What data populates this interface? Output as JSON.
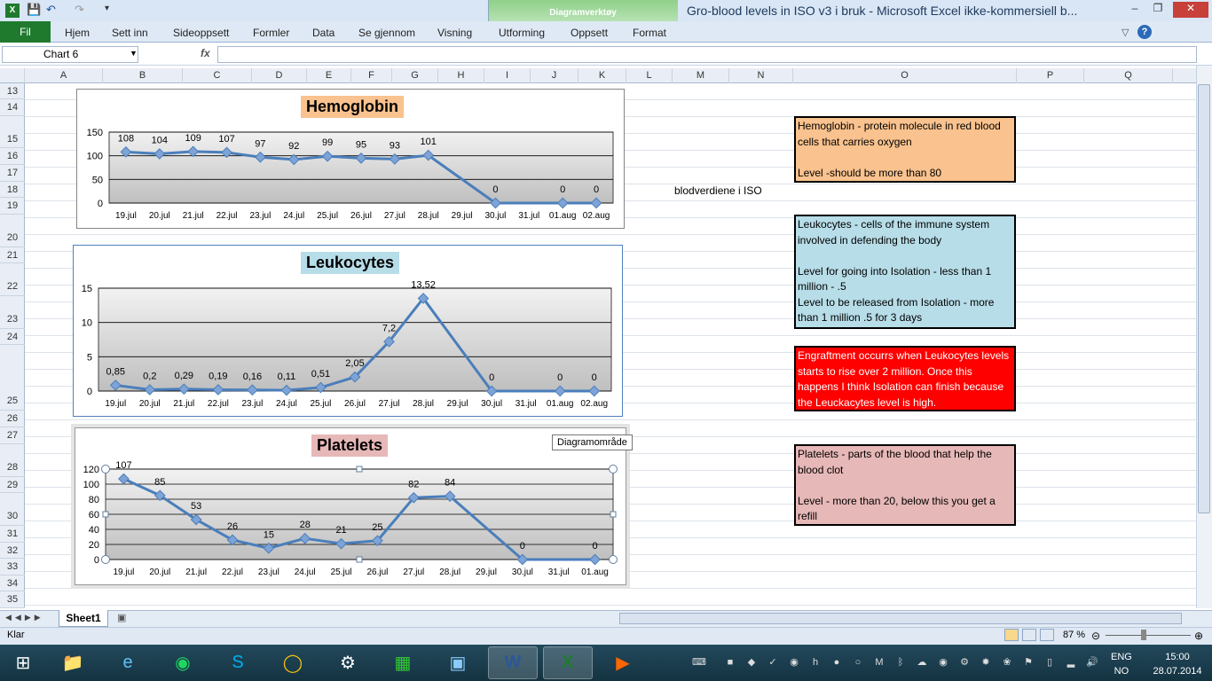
{
  "window": {
    "title": "Gro-blood levels in ISO v3 i bruk  -  Microsoft Excel ikke-kommersiell b...",
    "contextual_group": "Diagramverktøy"
  },
  "ribbon": {
    "file": "Fil",
    "tabs": [
      "Hjem",
      "Sett inn",
      "Sideoppsett",
      "Formler",
      "Data",
      "Se gjennom",
      "Visning",
      "Utforming",
      "Oppsett",
      "Format"
    ]
  },
  "formula_bar": {
    "name_box": "Chart 6",
    "fx": "fx",
    "value": ""
  },
  "columns": [
    "A",
    "B",
    "C",
    "D",
    "E",
    "F",
    "G",
    "H",
    "I",
    "J",
    "K",
    "L",
    "M",
    "N",
    "O",
    "P",
    "Q"
  ],
  "rows": [
    "13",
    "14",
    "15",
    "16",
    "17",
    "18",
    "19",
    "20",
    "21",
    "22",
    "23",
    "24",
    "25",
    "26",
    "27",
    "28",
    "29",
    "30",
    "31",
    "32",
    "33",
    "34",
    "35"
  ],
  "cell_text": "blodverdiene i ISO",
  "notes": {
    "hemoglobin": "Hemoglobin - protein molecule in red blood cells that carries oxygen\n\nLevel -should be more than 80",
    "leukocytes": "Leukocytes - cells of the immune system involved in defending the body\n\nLevel for going into Isolation - less than 1 million - .5\nLevel to be released from Isolation - more than 1 million .5 for 3 days",
    "engraftment": "Engraftment occurrs when Leukocytes levels starts to rise over 2 million. Once this happens I think Isolation can finish because the Leuckacytes level is high.",
    "platelets": "Platelets - parts of the blood that help the blood clot\n\nLevel - more than 20, below this you get a refill"
  },
  "note_colors": {
    "hemoglobin": "#f9c28e",
    "leukocytes": "#b7dde8",
    "engraftment": "#ff0000",
    "platelets": "#e6b8b7"
  },
  "tooltip": "Diagramområde",
  "sheet_tab": "Sheet1",
  "status": {
    "ready": "Klar",
    "zoom": "87 %"
  },
  "taskbar": {
    "apps": [
      "explorer-icon",
      "ie-icon",
      "spotify-icon",
      "skype-icon",
      "chrome-icon",
      "app-icon",
      "store-icon",
      "photos-icon",
      "word-icon",
      "excel-icon",
      "video-icon"
    ],
    "lang_top": "ENG",
    "lang_bottom": "NO",
    "time": "15:00",
    "date": "28.07.2014"
  },
  "chart_data": [
    {
      "type": "line",
      "title": "Hemoglobin",
      "categories": [
        "19.jul",
        "20.jul",
        "21.jul",
        "22.jul",
        "23.jul",
        "24.jul",
        "25.jul",
        "26.jul",
        "27.jul",
        "28.jul",
        "29.jul",
        "30.jul",
        "31.jul",
        "01.aug",
        "02.aug"
      ],
      "values": [
        108,
        104,
        109,
        107,
        97,
        92,
        99,
        95,
        93,
        101,
        null,
        0,
        null,
        0,
        0
      ],
      "data_labels": [
        "108",
        "104",
        "109",
        "107",
        "97",
        "92",
        "99",
        "95",
        "93",
        "101",
        "",
        "0",
        "",
        "0",
        "0"
      ],
      "yticks": [
        "0",
        "50",
        "100",
        "150"
      ],
      "ylim": [
        0,
        150
      ],
      "title_color": "#f9c28e"
    },
    {
      "type": "line",
      "title": "Leukocytes",
      "categories": [
        "19.jul",
        "20.jul",
        "21.jul",
        "22.jul",
        "23.jul",
        "24.jul",
        "25.jul",
        "26.jul",
        "27.jul",
        "28.jul",
        "29.jul",
        "30.jul",
        "31.jul",
        "01.aug",
        "02.aug"
      ],
      "values": [
        0.85,
        0.2,
        0.29,
        0.19,
        0.16,
        0.11,
        0.51,
        2.05,
        7.2,
        13.52,
        null,
        0,
        null,
        0,
        0
      ],
      "data_labels": [
        "0,85",
        "0,2",
        "0,29",
        "0,19",
        "0,16",
        "0,11",
        "0,51",
        "2,05",
        "7,2",
        "13,52",
        "",
        "0",
        "",
        "0",
        "0"
      ],
      "yticks": [
        "0",
        "5",
        "10",
        "15"
      ],
      "ylim": [
        0,
        15
      ],
      "title_color": "#b7dde8"
    },
    {
      "type": "line",
      "title": "Platelets",
      "categories": [
        "19.jul",
        "20.jul",
        "21.jul",
        "22.jul",
        "23.jul",
        "24.jul",
        "25.jul",
        "26.jul",
        "27.jul",
        "28.jul",
        "29.jul",
        "30.jul",
        "31.jul",
        "01.aug"
      ],
      "values": [
        107,
        85,
        53,
        26,
        15,
        28,
        21,
        25,
        82,
        84,
        null,
        0,
        null,
        0
      ],
      "data_labels": [
        "107",
        "85",
        "53",
        "26",
        "15",
        "28",
        "21",
        "25",
        "82",
        "84",
        "",
        "0",
        "",
        "0"
      ],
      "yticks": [
        "0",
        "20",
        "40",
        "60",
        "80",
        "100",
        "120"
      ],
      "ylim": [
        0,
        120
      ],
      "title_color": "#e6b8b7"
    }
  ]
}
